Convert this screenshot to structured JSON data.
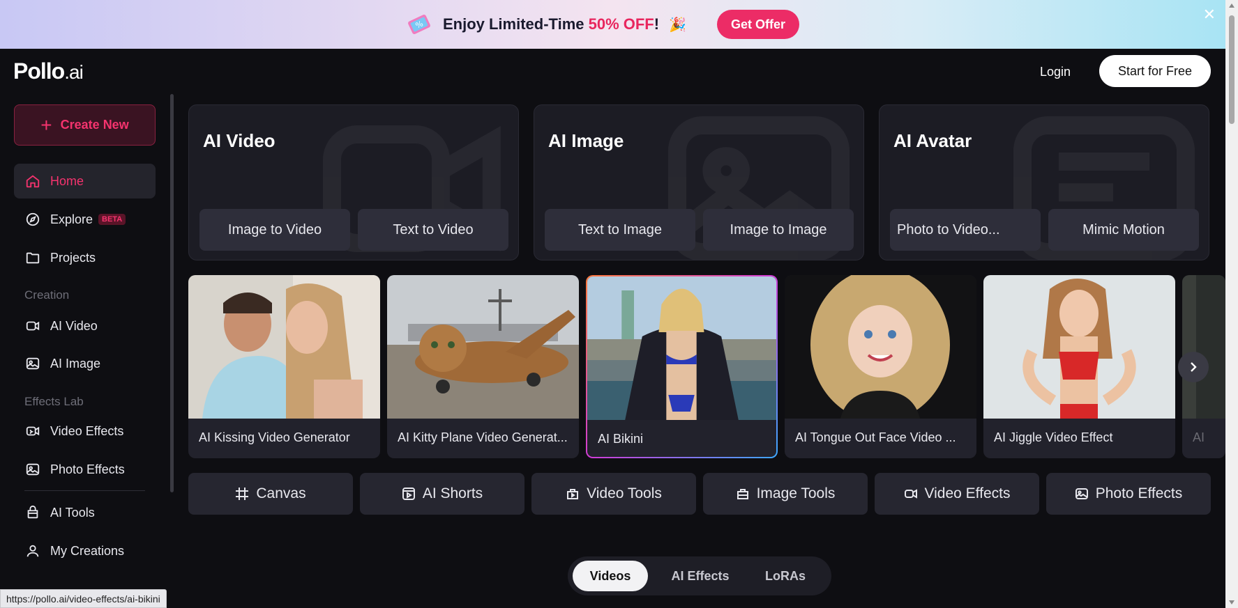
{
  "banner": {
    "text_prefix": "Enjoy Limited-Time ",
    "text_highlight": "50% OFF",
    "text_suffix": "!",
    "party": "🎉",
    "offer_label": "Get Offer",
    "close": "✕"
  },
  "header": {
    "logo_main": "Pollo",
    "logo_suffix": ".ai",
    "login_label": "Login",
    "start_label": "Start for Free"
  },
  "sidebar": {
    "create_label": "Create New",
    "home": "Home",
    "explore": "Explore",
    "explore_badge": "BETA",
    "projects": "Projects",
    "section_creation": "Creation",
    "ai_video": "AI Video",
    "ai_image": "AI Image",
    "section_effects": "Effects Lab",
    "video_effects": "Video Effects",
    "photo_effects": "Photo Effects",
    "ai_tools": "AI Tools",
    "my_creations": "My Creations"
  },
  "categories": [
    {
      "title": "AI Video",
      "buttons": [
        "Image to Video",
        "Text to Video"
      ]
    },
    {
      "title": "AI Image",
      "buttons": [
        "Text to Image",
        "Image to Image"
      ]
    },
    {
      "title": "AI Avatar",
      "buttons": [
        "Photo to Video...",
        "Mimic Motion"
      ]
    }
  ],
  "carousel": [
    {
      "caption": "AI Kissing Video Generator"
    },
    {
      "caption": "AI Kitty Plane Video Generat..."
    },
    {
      "caption": "AI Bikini"
    },
    {
      "caption": "AI Tongue Out Face Video ..."
    },
    {
      "caption": "AI Jiggle Video Effect"
    },
    {
      "caption": "AI"
    }
  ],
  "tools": [
    "Canvas",
    "AI Shorts",
    "Video Tools",
    "Image Tools",
    "Video Effects",
    "Photo Effects"
  ],
  "tabs": [
    "Videos",
    "AI Effects",
    "LoRAs"
  ],
  "status_url": "https://pollo.ai/video-effects/ai-bikini",
  "colors": {
    "accent": "#f5336e",
    "background": "#0e0e12",
    "card": "#1c1c24"
  }
}
